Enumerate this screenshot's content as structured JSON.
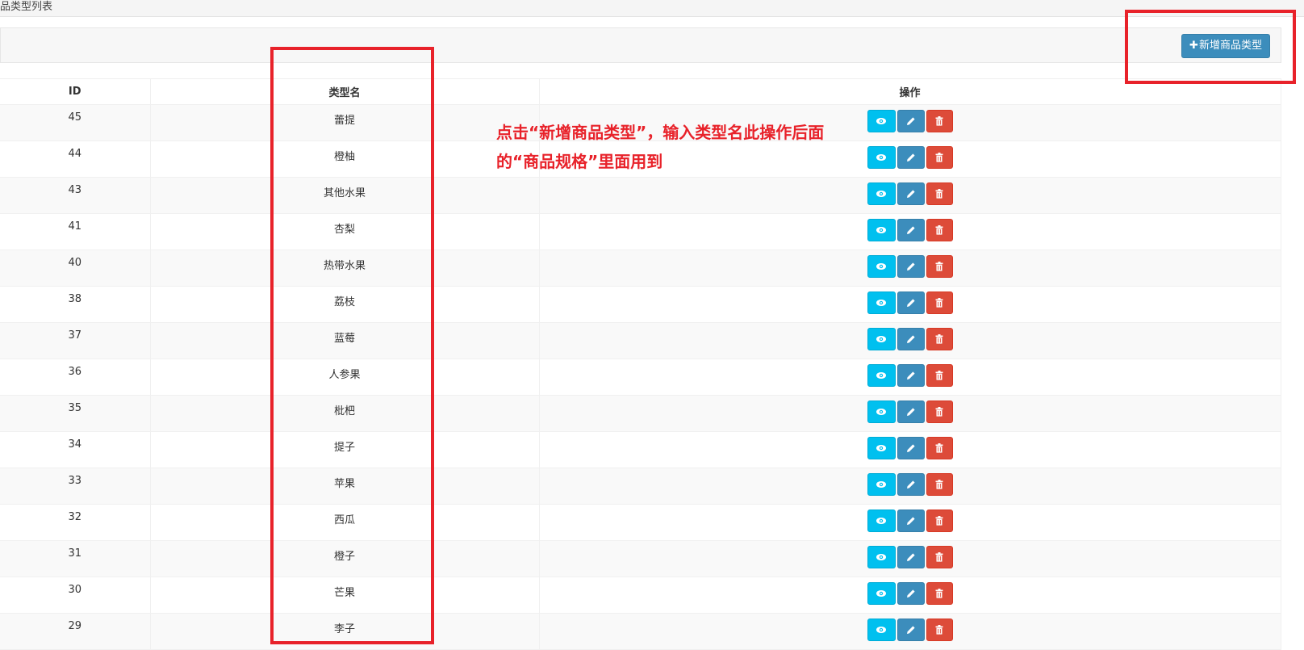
{
  "page_header": {
    "title": "品类型列表"
  },
  "toolbar": {
    "add_button_label": "新增商品类型",
    "add_button_icon": "plus-icon"
  },
  "table": {
    "headers": {
      "id": "ID",
      "name": "类型名",
      "ops": "操作"
    },
    "rows": [
      {
        "id": "45",
        "name": "蕾提"
      },
      {
        "id": "44",
        "name": "橙柚"
      },
      {
        "id": "43",
        "name": "其他水果"
      },
      {
        "id": "41",
        "name": "杏梨"
      },
      {
        "id": "40",
        "name": "热带水果"
      },
      {
        "id": "38",
        "name": "荔枝"
      },
      {
        "id": "37",
        "name": "蓝莓"
      },
      {
        "id": "36",
        "name": "人参果"
      },
      {
        "id": "35",
        "name": "枇杷"
      },
      {
        "id": "34",
        "name": "提子"
      },
      {
        "id": "33",
        "name": "苹果"
      },
      {
        "id": "32",
        "name": "西瓜"
      },
      {
        "id": "31",
        "name": "橙子"
      },
      {
        "id": "30",
        "name": "芒果"
      },
      {
        "id": "29",
        "name": "李子"
      }
    ],
    "action_icons": [
      "eye-icon",
      "pencil-icon",
      "trash-icon"
    ]
  },
  "annotation": {
    "line1": "点击“新增商品类型”，输入类型名此操作后面",
    "line2": "的“商品规格”里面用到"
  },
  "colors": {
    "primary": "#3c8dbc",
    "info": "#00c0ef",
    "danger": "#dd4b39",
    "highlight": "#e8222a"
  }
}
